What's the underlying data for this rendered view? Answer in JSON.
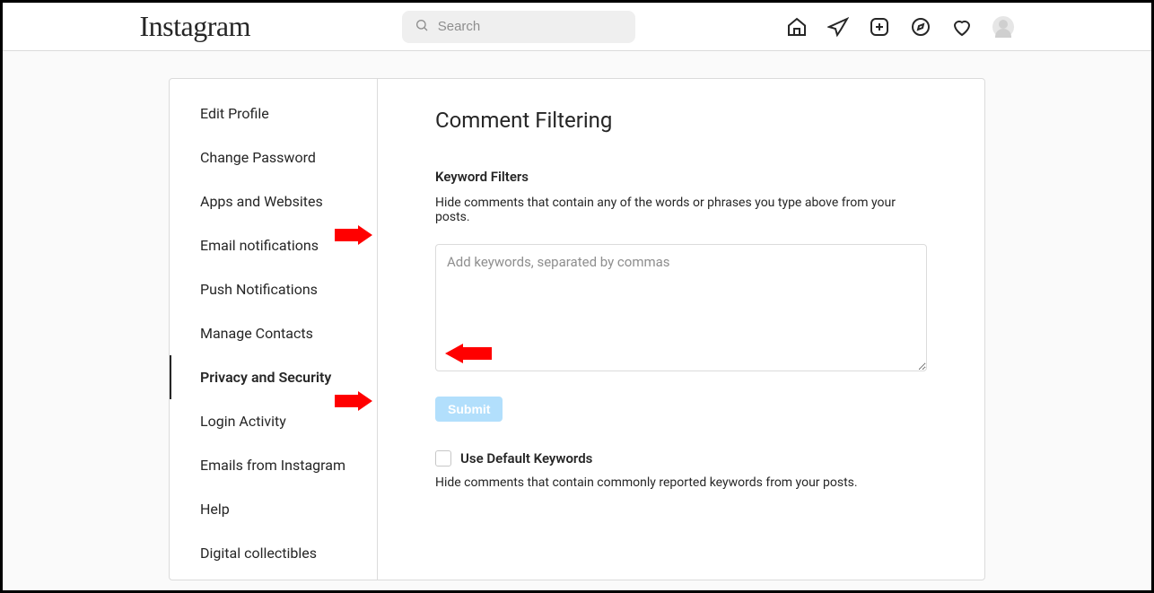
{
  "header": {
    "logo": "Instagram",
    "search_placeholder": "Search"
  },
  "sidebar": {
    "items": [
      {
        "label": "Edit Profile"
      },
      {
        "label": "Change Password"
      },
      {
        "label": "Apps and Websites"
      },
      {
        "label": "Email notifications"
      },
      {
        "label": "Push Notifications"
      },
      {
        "label": "Manage Contacts"
      },
      {
        "label": "Privacy and Security"
      },
      {
        "label": "Login Activity"
      },
      {
        "label": "Emails from Instagram"
      },
      {
        "label": "Help"
      },
      {
        "label": "Digital collectibles"
      }
    ],
    "active_index": 6
  },
  "main": {
    "title": "Comment Filtering",
    "keyword_filters": {
      "heading": "Keyword Filters",
      "description": "Hide comments that contain any of the words or phrases you type above from your posts.",
      "placeholder": "Add keywords, separated by commas",
      "value": "",
      "submit_label": "Submit"
    },
    "default_keywords": {
      "checkbox_label": "Use Default Keywords",
      "checked": false,
      "description": "Hide comments that contain commonly reported keywords from your posts."
    }
  }
}
